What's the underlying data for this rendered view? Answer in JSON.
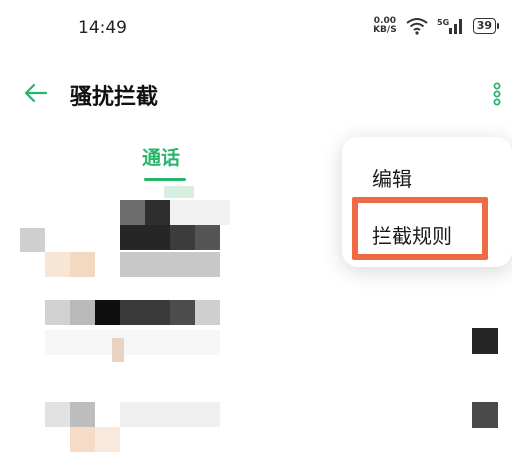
{
  "status_bar": {
    "time": "14:49",
    "net_speed_value": "0.00",
    "net_speed_unit": "KB/S",
    "signal_label": "5G",
    "battery_level": "39"
  },
  "header": {
    "title": "骚扰拦截",
    "back_icon": "arrow-left-icon",
    "more_icon": "more-vertical-icon"
  },
  "tabs": [
    {
      "label": "通话",
      "active": true
    }
  ],
  "menu": {
    "items": [
      {
        "label": "编辑"
      },
      {
        "label": "拦截规则",
        "highlighted": true
      }
    ]
  },
  "colors": {
    "accent": "#27b56a",
    "highlight": "#ee6a45"
  }
}
